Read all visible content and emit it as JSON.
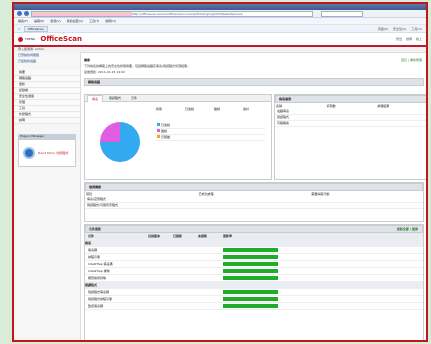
{
  "browser": {
    "url": "http://officescan-server/officescan/console/html/cgi/cgiChkMasterPwd.exe",
    "menu": [
      "檔案(F)",
      "編輯(E)",
      "檢視(V)",
      "我的最愛(A)",
      "工具(T)",
      "說明(H)"
    ],
    "fav_tab": "OfficeScan",
    "tools": [
      "頁面(P)",
      "安全性(S)",
      "工具(O)"
    ]
  },
  "app": {
    "brand": "TREND",
    "product": "OfficeScan",
    "header_links": [
      "登出",
      "說明",
      "線上"
    ],
    "user_line": "登入使用者: admin"
  },
  "sidebar": {
    "links": [
      "已登錄的伺服器",
      "已連線的電腦"
    ],
    "nav": [
      "摘要",
      "網路電腦",
      "更新",
      "記錄檔",
      "安全性遵循",
      "管理",
      "工具",
      "外掛程式",
      "說明"
    ],
    "plugin_head": "Plug-in Manager",
    "plugin_text": "Trend Micro 外掛程式"
  },
  "main": {
    "title": "摘要",
    "title_links": "自訂 | 重新整理",
    "desc": "下列為您的網路上的安全性狀態摘要，包括網路電腦及病毒/間諜程式偵測結果。",
    "desc2": "最後更新: 2011-01-15 14:00",
    "status_head": "網路電腦",
    "tabs": [
      "病毒",
      "間諜程式",
      "元件"
    ],
    "columns": [
      "狀態",
      "已連線",
      "離線",
      "總計"
    ],
    "legend": [
      "已連線",
      "離線",
      "已隔離"
    ],
    "right_head": "病毒偵測",
    "right_cols": [
      "名稱",
      "偵測數",
      "處理結果"
    ],
    "right_rows": [
      "電腦病毒",
      "間諜程式",
      "可疑檔案"
    ],
    "mid_head": "偵測摘要",
    "mid_cols": [
      "項目",
      "已成功處理",
      "需要採取行動"
    ],
    "mid_rows": [
      "病毒/惡意程式",
      "間諜程式/可能有害程式"
    ],
    "update_head": "元件更新",
    "update_links": "更新全部 | 復原",
    "update_cols": [
      "元件",
      "目前版本",
      "已更新",
      "未更新",
      "更新率"
    ],
    "update_group1": "病毒",
    "update_group2": "間諜程式",
    "update_rows1": [
      "病毒碼",
      "掃瞄引擎",
      "IntelliTrap 病毒碼",
      "IntelliTrap 排除",
      "網頁信譽評等"
    ],
    "update_rows2": [
      "間諜程式病毒碼",
      "間諜程式掃瞄引擎",
      "監控病毒碼"
    ]
  },
  "chart_data": {
    "type": "pie",
    "categories": [
      "已連線",
      "離線",
      "已隔離"
    ],
    "values": [
      75,
      25,
      0
    ],
    "colors": [
      "#33aaf0",
      "#e25ee0",
      "#ff9f1c"
    ]
  }
}
